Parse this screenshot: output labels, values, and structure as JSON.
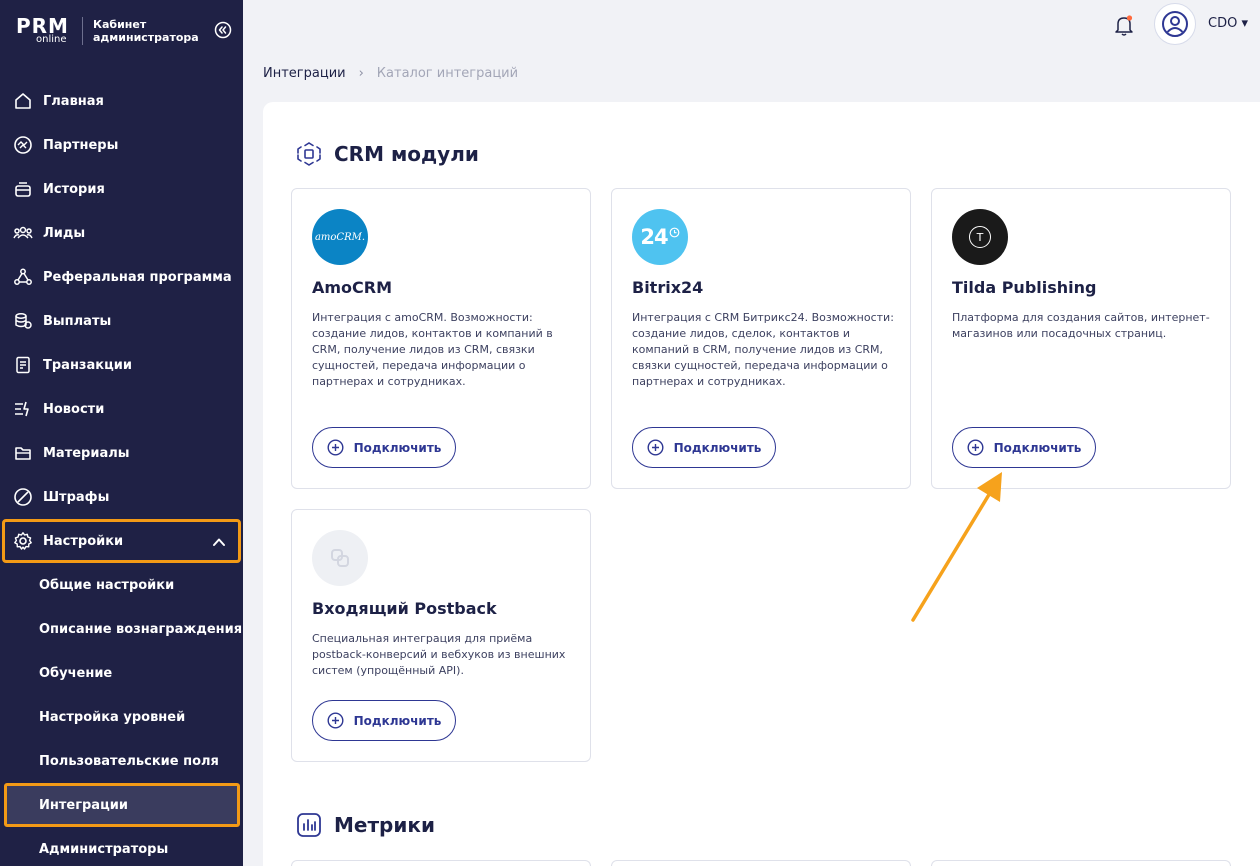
{
  "brand": {
    "logo_top": "PRM",
    "logo_bottom": "online",
    "title_line1": "Кабинет",
    "title_line2": "администратора"
  },
  "nav": {
    "items": [
      {
        "label": "Главная",
        "icon": "home-icon"
      },
      {
        "label": "Партнеры",
        "icon": "partners-icon"
      },
      {
        "label": "История",
        "icon": "history-icon"
      },
      {
        "label": "Лиды",
        "icon": "leads-icon"
      },
      {
        "label": "Реферальная программа",
        "icon": "referral-icon"
      },
      {
        "label": "Выплаты",
        "icon": "coins-icon"
      },
      {
        "label": "Транзакции",
        "icon": "receipt-icon"
      },
      {
        "label": "Новости",
        "icon": "news-icon"
      },
      {
        "label": "Материалы",
        "icon": "materials-icon"
      },
      {
        "label": "Штрафы",
        "icon": "fines-icon"
      },
      {
        "label": "Настройки",
        "icon": "gear-icon"
      }
    ],
    "sub_items": [
      {
        "label": "Общие настройки"
      },
      {
        "label": "Описание вознаграждения"
      },
      {
        "label": "Обучение"
      },
      {
        "label": "Настройка уровней"
      },
      {
        "label": "Пользовательские поля"
      },
      {
        "label": "Интеграции"
      },
      {
        "label": "Администраторы"
      }
    ]
  },
  "header": {
    "user_name": "CDO ▾"
  },
  "breadcrumb": {
    "parent": "Интеграции",
    "separator": "›",
    "current": "Каталог интеграций"
  },
  "sections": {
    "crm_title": "CRM модули",
    "metrics_title": "Метрики"
  },
  "cards": [
    {
      "title": "AmoCRM",
      "logo_text": "amoCRM.",
      "description": "Интеграция с amoCRM. Возможности: создание лидов, контактов и компаний в CRM, получение лидов из CRM, связки сущностей, передача информации о партнерах и сотрудниках.",
      "button": "Подключить"
    },
    {
      "title": "Bitrix24",
      "logo_text": "24",
      "description": "Интеграция с CRM Битрикс24. Возможности: создание лидов, сделок, контактов и компаний в CRM, получение лидов из CRM, связки сущностей, передача информации о партнерах и сотрудниках.",
      "button": "Подключить"
    },
    {
      "title": "Tilda Publishing",
      "logo_text": "T",
      "description": "Платформа для создания сайтов, интернет-магазинов или посадочных страниц.",
      "button": "Подключить"
    },
    {
      "title": "Входящий Postback",
      "description": "Специальная интеграция для приёма postback-конверсий и вебхуков из внешних систем (упрощённый API).",
      "button": "Подключить"
    }
  ],
  "colors": {
    "sidebar_bg": "#1f2145",
    "highlight": "#f39a16",
    "accent": "#2e3793",
    "amocrm": "#0b84c5",
    "bitrix": "#4fc3f0",
    "tilda": "#1a1a1a"
  }
}
